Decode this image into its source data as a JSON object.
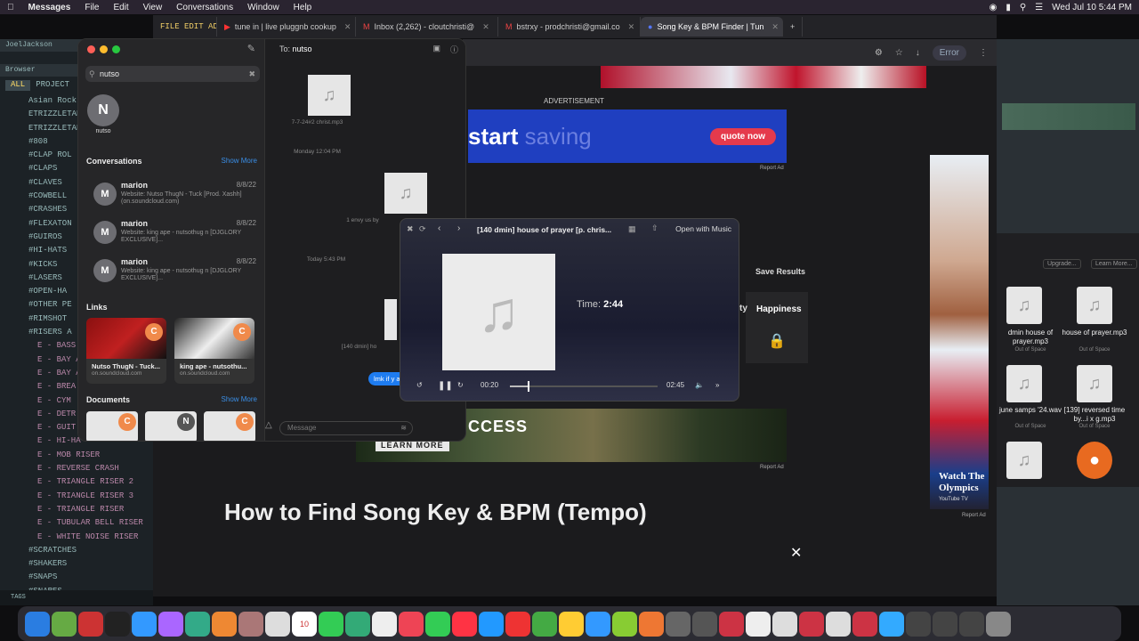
{
  "menubar": {
    "app": "Messages",
    "items": [
      "File",
      "Edit",
      "View",
      "Conversations",
      "Window",
      "Help"
    ],
    "datetime": "Wed Jul 10  5:44 PM"
  },
  "browser": {
    "tabs": [
      {
        "label": "FILE EDIT ADD PATTERNS VIEW OP"
      },
      {
        "label": "tune in | live pluggnb cookup"
      },
      {
        "label": "Inbox (2,262) - cloutchristi@"
      },
      {
        "label": "bstrxy - prodchristi@gmail.co"
      },
      {
        "label": "Song Key & BPM Finder | Tun"
      }
    ],
    "error_label": "Error"
  },
  "fl_left": {
    "user": "JoelJackson",
    "browser_label": "Browser",
    "tab_all": "ALL",
    "tab_project": "PROJECT",
    "folders": [
      "Asian Rock D",
      "ETRIZZLETAB",
      "ETRIZZLETAB",
      "#808",
      "#CLAP ROL",
      "#CLAPS",
      "#CLAVES",
      "#COWBELL",
      "#CRASHES",
      "#FLEXATON",
      "#GUIROS",
      "#HI-HATS",
      "#KICKS",
      "#LASERS",
      "#OPEN-HA",
      "#OTHER PE",
      "#RIMSHOT",
      "#RISERS A",
      "E - BASS",
      "E - BAY A",
      "E - BAY A",
      "E - BREA",
      "E - CYM",
      "E - DETR",
      "E - GUIT",
      "E - HI-HA",
      "E - MOB RISER",
      "E - REVERSE CRASH",
      "E - TRIANGLE RISER 2",
      "E - TRIANGLE RISER 3",
      "E - TRIANGLE RISER",
      "E - TUBULAR BELL RISER",
      "E - WHITE NOISE RISER",
      "#SCRATCHES",
      "#SHAKERS",
      "#SNAPS",
      "#SNARES"
    ],
    "tags_label": "TAGS"
  },
  "webpage": {
    "advertisement": "ADVERTISEMENT",
    "ad1_word1": "start",
    "ad1_word2": "saving",
    "ad1_button": "quote now",
    "report_ad": "Report Ad",
    "ad2_text": "CCESS",
    "ad2_button": "LEARN MORE",
    "save_results": "Save Results",
    "col_partial": "ty",
    "col_happiness": "Happiness",
    "heading": "How to Find Song Key & BPM (Tempo)",
    "olympics": "Watch The Olympics",
    "olympics_sub": "YouTube TV"
  },
  "messages": {
    "search_value": "nutso",
    "contact_initial": "N",
    "contact_name": "nutso",
    "conversations_label": "Conversations",
    "show_more": "Show More",
    "conversations": [
      {
        "initial": "M",
        "name": "marion",
        "date": "8/8/22",
        "preview": "Website: Nutso ThugN - Tuck [Prod. Xashh] (on.soundcloud.com)"
      },
      {
        "initial": "M",
        "name": "marion",
        "date": "8/8/22",
        "preview": "Website: king ape - nutsothug n [DJGLORY EXCLUSIVE]..."
      },
      {
        "initial": "M",
        "name": "marion",
        "date": "8/8/22",
        "preview": "Website: king ape - nutsothug n [DJGLORY EXCLUSIVE]..."
      }
    ],
    "links_label": "Links",
    "links": [
      {
        "title": "Nutso ThugN - Tuck...",
        "site": "on.soundcloud.com",
        "badge": "C"
      },
      {
        "title": "king ape - nutsothu...",
        "site": "on.soundcloud.com",
        "badge": "C"
      }
    ],
    "documents_label": "Documents",
    "doc_badges": [
      "C",
      "N",
      "C"
    ],
    "to_label": "To:",
    "to_value": "nutso",
    "attachment1": "7-7-24#2 christ.mp3",
    "time_monday": "Monday 12:04 PM",
    "attachment2": "1 envy us by",
    "time_today": "Today 5:43 PM",
    "attachment3": "[140 dmin] ho",
    "bubble": "lmk if y arrang",
    "message_placeholder": "Message"
  },
  "player": {
    "title": "[140 dmin] house of prayer [p. chris...",
    "open_with": "Open with Music",
    "time_label": "Time:",
    "time_value": "2:44",
    "elapsed": "00:20",
    "duration": "02:45",
    "progress": 0.12
  },
  "finder": {
    "btn_upgrade": "Upgrade...",
    "btn_learn": "Learn More...",
    "files": [
      {
        "name": "dmin house of prayer.mp3",
        "sub": "Out of Space"
      },
      {
        "name": "house of prayer.mp3",
        "sub": "Out of Space"
      },
      {
        "name": "june samps '24.wav",
        "sub": "Out of Space"
      },
      {
        "name": "[139] reversed time by...i x g.mp3",
        "sub": "Out of Space"
      }
    ]
  },
  "dock": {
    "date_badge": "10"
  }
}
